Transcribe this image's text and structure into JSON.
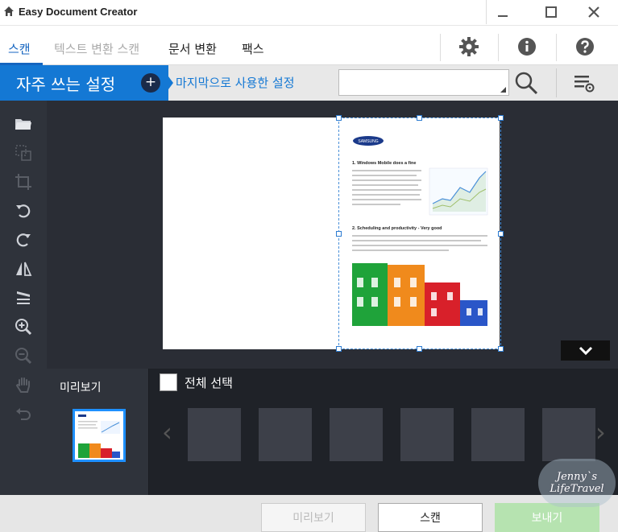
{
  "window": {
    "title": "Easy Document Creator"
  },
  "tabs": [
    {
      "label": "스캔"
    },
    {
      "label": "텍스트 변환 스캔"
    },
    {
      "label": "문서 변환"
    },
    {
      "label": "팩스"
    }
  ],
  "presets": {
    "favorites_label": "자주 쓰는 설정",
    "add_symbol": "+",
    "last_used_label": "마지막으로 사용한 설정",
    "search_value": ""
  },
  "preview": {
    "label": "미리보기",
    "select_all_label": "전체 선택"
  },
  "document": {
    "logo_text": "SAMSUNG",
    "heading1": "1. Windows Mobile does a fine",
    "heading2": "2. Scheduling and productivity - Very good"
  },
  "footer": {
    "preview_button": "미리보기",
    "scan_button": "스캔",
    "send_button": "보내기"
  },
  "watermark": {
    "line1": "Jenny`s",
    "line2": "LifeTravel"
  },
  "colors": {
    "accent": "#1478d4",
    "dark": "#2f333b",
    "send": "#b6e3b0"
  }
}
